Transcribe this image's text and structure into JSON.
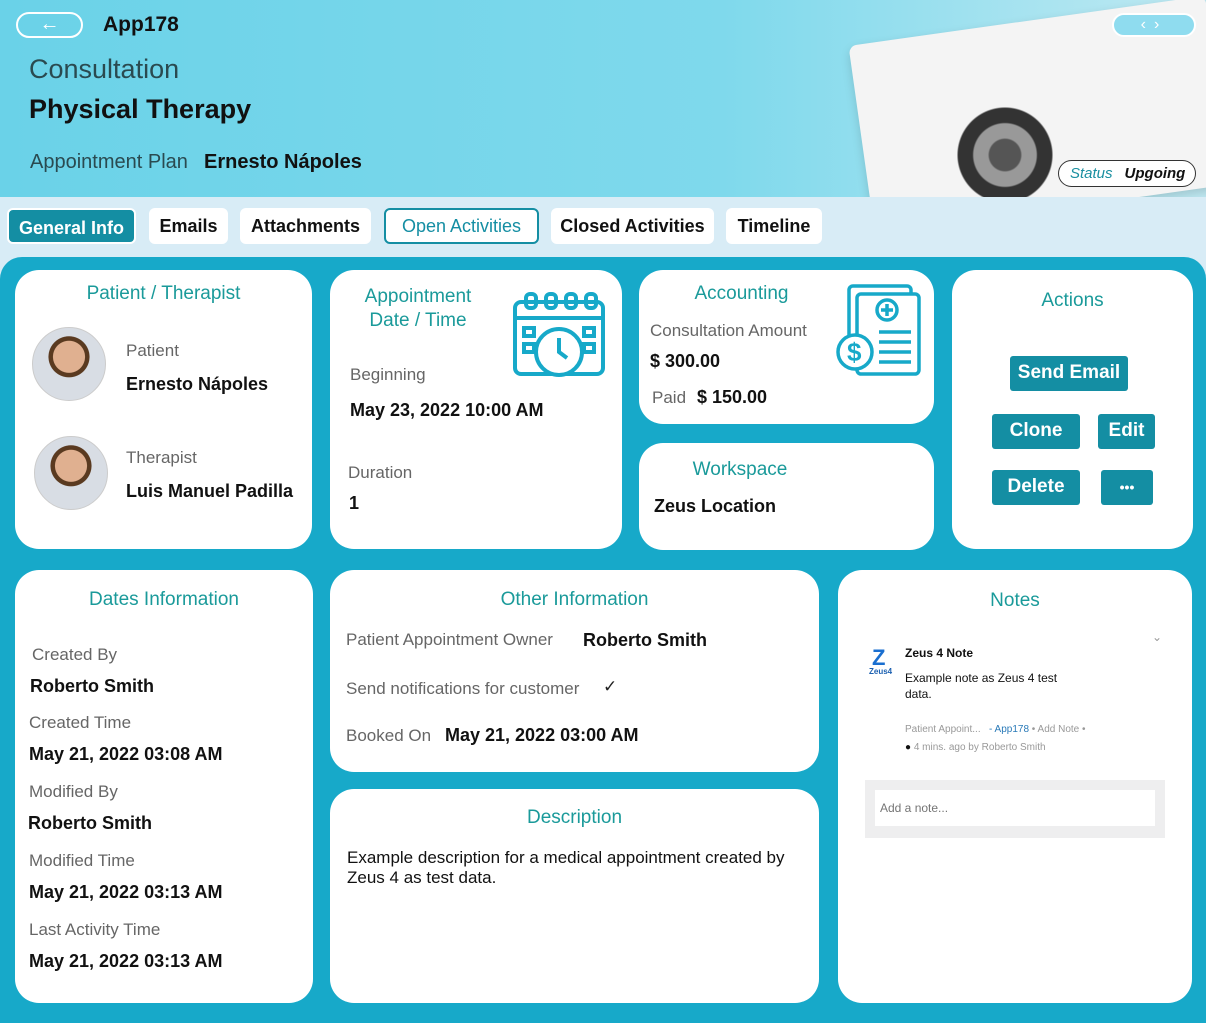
{
  "header": {
    "app_id": "App178",
    "type": "Consultation",
    "title": "Physical Therapy",
    "plan_label": "Appointment Plan",
    "plan_value": "Ernesto Nápoles",
    "status_label": "Status",
    "status_value": "Upgoing"
  },
  "tabs": [
    {
      "label": "General Info"
    },
    {
      "label": "Emails"
    },
    {
      "label": "Attachments"
    },
    {
      "label": "Open Activities"
    },
    {
      "label": "Closed Activities"
    },
    {
      "label": "Timeline"
    }
  ],
  "patient_card": {
    "title": "Patient / Therapist",
    "patient_label": "Patient",
    "patient_name": "Ernesto Nápoles",
    "therapist_label": "Therapist",
    "therapist_name": "Luis Manuel Padilla"
  },
  "appointment_card": {
    "title": "Appointment Date / Time",
    "beginning_label": "Beginning",
    "beginning_value": "May 23, 2022 10:00 AM",
    "duration_label": "Duration",
    "duration_value": "1"
  },
  "accounting_card": {
    "title": "Accounting",
    "amount_label": "Consultation Amount",
    "amount_value": "$ 300.00",
    "paid_label": "Paid",
    "paid_value": "$ 150.00"
  },
  "workspace_card": {
    "title": "Workspace",
    "value": "Zeus Location"
  },
  "actions_card": {
    "title": "Actions",
    "send_email": "Send Email",
    "clone": "Clone",
    "edit": "Edit",
    "delete": "Delete",
    "more": "•••"
  },
  "dates_card": {
    "title": "Dates Information",
    "created_by_label": "Created By",
    "created_by": "Roberto Smith",
    "created_time_label": "Created Time",
    "created_time": "May 21, 2022 03:08 AM",
    "modified_by_label": "Modified By",
    "modified_by": "Roberto Smith",
    "modified_time_label": "Modified Time",
    "modified_time": "May 21, 2022 03:13 AM",
    "last_activity_label": "Last Activity Time",
    "last_activity": "May 21, 2022 03:13 AM"
  },
  "other_card": {
    "title": "Other Information",
    "owner_label": "Patient Appointment Owner",
    "owner": "Roberto Smith",
    "notify_label": "Send notifications for customer",
    "notify_check": "✓",
    "booked_label": "Booked On",
    "booked": "May 21, 2022 03:00 AM"
  },
  "description_card": {
    "title": "Description",
    "text": "Example description for a medical appointment created by Zeus 4 as test data."
  },
  "notes_card": {
    "title": "Notes",
    "logo_text": "Zeus4",
    "note_title": "Zeus 4 Note",
    "note_body": "Example note as  Zeus 4  test data.",
    "meta_module": "Patient Appoint...",
    "meta_record": "- App178",
    "meta_sep1": "•",
    "meta_action": "Add Note",
    "meta_sep2": "•",
    "meta_time": "4 mins. ago  by",
    "meta_author": "Roberto Smith",
    "add_placeholder": "Add a note..."
  },
  "colors": {
    "accent": "#148ea3",
    "title_teal": "#1a9a9a",
    "main_bg": "#17a9c9"
  }
}
